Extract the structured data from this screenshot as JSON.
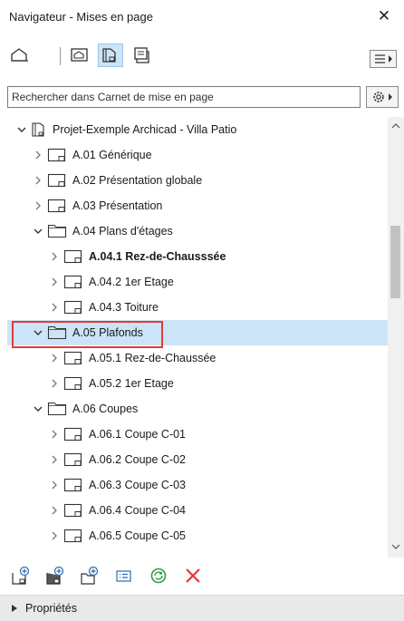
{
  "window": {
    "title": "Navigateur - Mises en page",
    "close_glyph": "✕"
  },
  "toolbar": {
    "buttons": [
      {
        "icon": "project-map-icon",
        "selected": false
      },
      {
        "icon": "view-map-icon",
        "selected": false
      },
      {
        "icon": "layout-book-icon",
        "selected": true
      },
      {
        "icon": "publisher-sets-icon",
        "selected": false
      }
    ],
    "menu_icon": "list-menu-icon"
  },
  "search": {
    "placeholder": "Rechercher dans Carnet de mise en page",
    "settings_icon": "gear-icon"
  },
  "tree": {
    "root": {
      "label": "Projet-Exemple Archicad - Villa Patio"
    },
    "items": [
      {
        "label": "A.01 Générique",
        "type": "layout",
        "expanded": false,
        "level": 1
      },
      {
        "label": "A.02 Présentation globale",
        "type": "layout",
        "expanded": false,
        "level": 1
      },
      {
        "label": "A.03 Présentation",
        "type": "layout",
        "expanded": false,
        "level": 1
      },
      {
        "label": "A.04 Plans d'étages",
        "type": "folder",
        "expanded": true,
        "level": 1
      },
      {
        "label": "A.04.1 Rez-de-Chausssée",
        "type": "layout",
        "expanded": false,
        "level": 2,
        "bold": true
      },
      {
        "label": "A.04.2 1er Etage",
        "type": "layout",
        "expanded": false,
        "level": 2
      },
      {
        "label": "A.04.3 Toiture",
        "type": "layout",
        "expanded": false,
        "level": 2
      },
      {
        "label": "A.05 Plafonds",
        "type": "folder",
        "expanded": true,
        "level": 1,
        "selected": true
      },
      {
        "label": "A.05.1 Rez-de-Chaussée",
        "type": "layout",
        "expanded": false,
        "level": 2
      },
      {
        "label": "A.05.2 1er Etage",
        "type": "layout",
        "expanded": false,
        "level": 2
      },
      {
        "label": "A.06 Coupes",
        "type": "folder",
        "expanded": true,
        "level": 1
      },
      {
        "label": "A.06.1 Coupe C-01",
        "type": "layout",
        "expanded": false,
        "level": 2
      },
      {
        "label": "A.06.2 Coupe C-02",
        "type": "layout",
        "expanded": false,
        "level": 2
      },
      {
        "label": "A.06.3 Coupe C-03",
        "type": "layout",
        "expanded": false,
        "level": 2
      },
      {
        "label": "A.06.4 Coupe C-04",
        "type": "layout",
        "expanded": false,
        "level": 2
      },
      {
        "label": "A.06.5 Coupe C-05",
        "type": "layout",
        "expanded": false,
        "level": 2
      }
    ]
  },
  "bottom_toolbar": {
    "buttons": [
      {
        "icon": "new-layout-icon"
      },
      {
        "icon": "new-master-layout-icon"
      },
      {
        "icon": "new-subset-icon"
      },
      {
        "icon": "layout-settings-icon"
      },
      {
        "icon": "update-icon"
      },
      {
        "icon": "delete-icon"
      }
    ]
  },
  "properties": {
    "label": "Propriétés"
  },
  "colors": {
    "selection": "#cce4f7",
    "highlight_border": "#e53935",
    "update_green": "#2e9e3a",
    "delete_red": "#e53935",
    "icon_blue": "#2b6cb0"
  }
}
